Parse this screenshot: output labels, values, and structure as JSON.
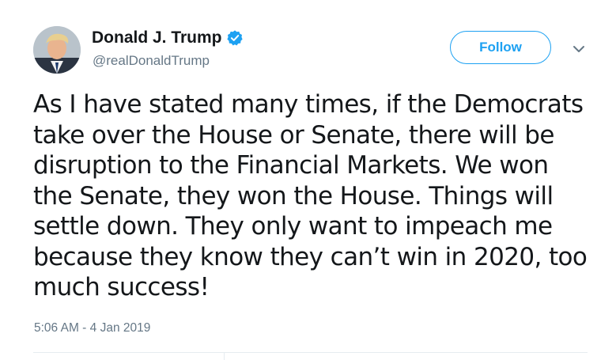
{
  "author": {
    "display_name": "Donald J. Trump",
    "handle": "@realDonaldTrump",
    "verified": true,
    "avatar_icon": "profile-photo"
  },
  "actions": {
    "follow_label": "Follow",
    "menu_icon": "chevron-down-icon"
  },
  "tweet": {
    "text": "As I have stated many times, if the Democrats\ntake over the House or Senate, there will be\ndisruption to the Financial Markets. We won\nthe Senate, they won the House. Things will\nsettle down. They only want to impeach me\nbecause they know they can’t win in 2020, too\nmuch success!",
    "timestamp": "5:06 AM - 4 Jan 2019"
  },
  "colors": {
    "accent": "#1da1f2",
    "secondary_text": "#657786",
    "primary_text": "#14171a"
  }
}
